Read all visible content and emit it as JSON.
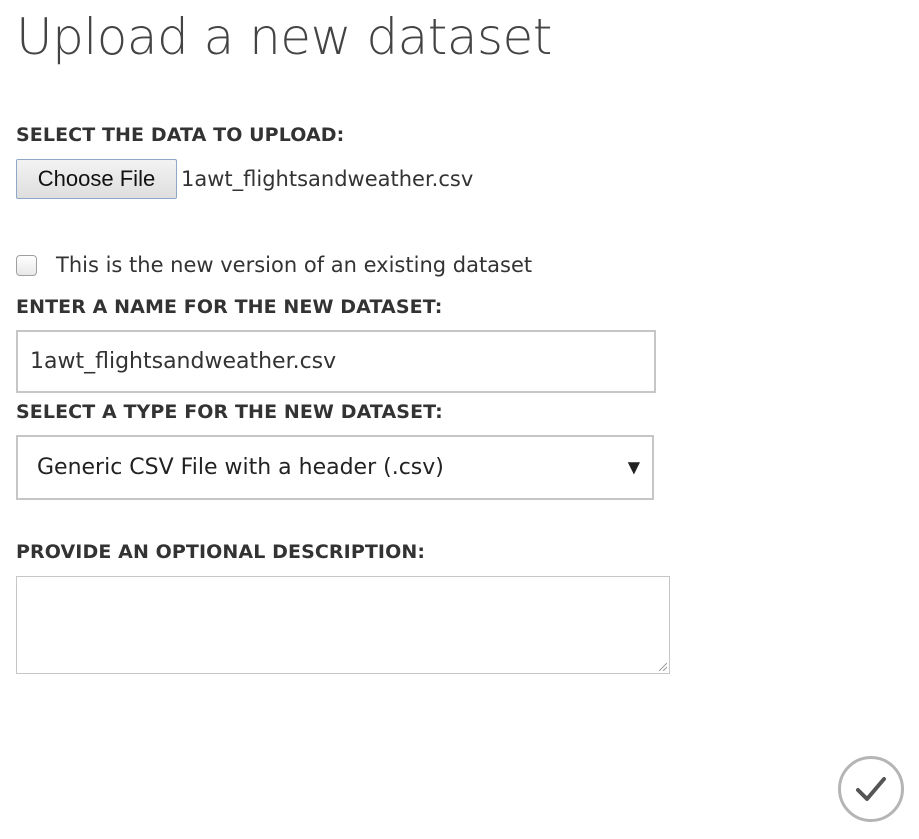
{
  "page": {
    "title": "Upload a new dataset"
  },
  "upload": {
    "label": "SELECT THE DATA TO UPLOAD:",
    "choose_button_label": "Choose File",
    "selected_file": "1awt_flightsandweather.csv"
  },
  "version_checkbox": {
    "label": "This is the new version of an existing dataset",
    "checked": false
  },
  "name_field": {
    "label": "ENTER A NAME FOR THE NEW DATASET:",
    "value": "1awt_flightsandweather.csv"
  },
  "type_field": {
    "label": "SELECT A TYPE FOR THE NEW DATASET:",
    "selected_option": "Generic CSV File with a header (.csv)",
    "arrow_icon": "dropdown-triangle"
  },
  "description_field": {
    "label": "PROVIDE AN OPTIONAL DESCRIPTION:",
    "value": ""
  },
  "ok_button": {
    "icon": "checkmark",
    "border_color": "#b5b5b5",
    "icon_color": "#555555"
  }
}
